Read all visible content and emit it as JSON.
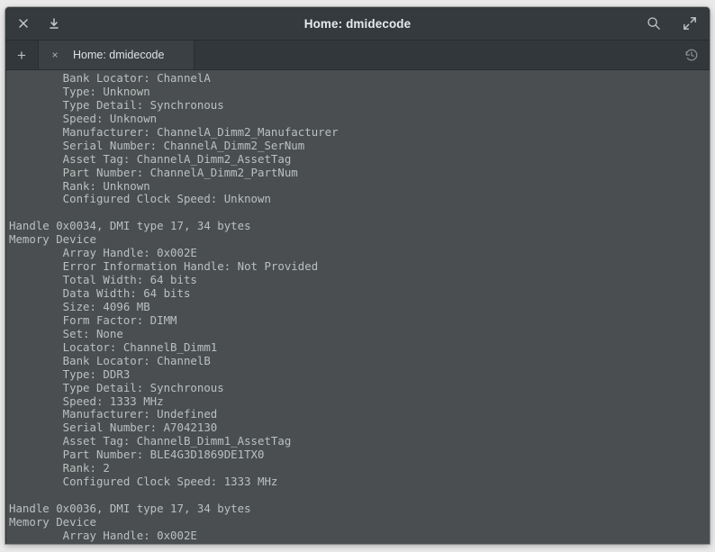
{
  "window": {
    "title": "Home: dmidecode",
    "titlebar_icons": {
      "close": "close-icon",
      "minimize": "minimize-down-icon",
      "search": "search-icon",
      "fullscreen": "fullscreen-expand-icon"
    }
  },
  "tabbar": {
    "new_tab_label": "+",
    "close_tab_label": "×",
    "tab_label": "Home: dmidecode",
    "history_icon": "history-clock-icon"
  },
  "terminal": {
    "lines": [
      "        Bank Locator: ChannelA",
      "        Type: Unknown",
      "        Type Detail: Synchronous",
      "        Speed: Unknown",
      "        Manufacturer: ChannelA_Dimm2_Manufacturer",
      "        Serial Number: ChannelA_Dimm2_SerNum",
      "        Asset Tag: ChannelA_Dimm2_AssetTag",
      "        Part Number: ChannelA_Dimm2_PartNum",
      "        Rank: Unknown",
      "        Configured Clock Speed: Unknown",
      "",
      "Handle 0x0034, DMI type 17, 34 bytes",
      "Memory Device",
      "        Array Handle: 0x002E",
      "        Error Information Handle: Not Provided",
      "        Total Width: 64 bits",
      "        Data Width: 64 bits",
      "        Size: 4096 MB",
      "        Form Factor: DIMM",
      "        Set: None",
      "        Locator: ChannelB_Dimm1",
      "        Bank Locator: ChannelB",
      "        Type: DDR3",
      "        Type Detail: Synchronous",
      "        Speed: 1333 MHz",
      "        Manufacturer: Undefined",
      "        Serial Number: A7042130",
      "        Asset Tag: ChannelB_Dimm1_AssetTag",
      "        Part Number: BLE4G3D1869DE1TX0",
      "        Rank: 2",
      "        Configured Clock Speed: 1333 MHz",
      "",
      "Handle 0x0036, DMI type 17, 34 bytes",
      "Memory Device",
      "        Array Handle: 0x002E"
    ]
  },
  "colors": {
    "titlebar_bg": "#343a3d",
    "tabbar_bg": "#31373a",
    "active_tab_bg": "#3a4043",
    "terminal_bg": "#4a4e51",
    "terminal_fg": "#b9c1be",
    "desktop_bg": "#e9e9e9"
  }
}
